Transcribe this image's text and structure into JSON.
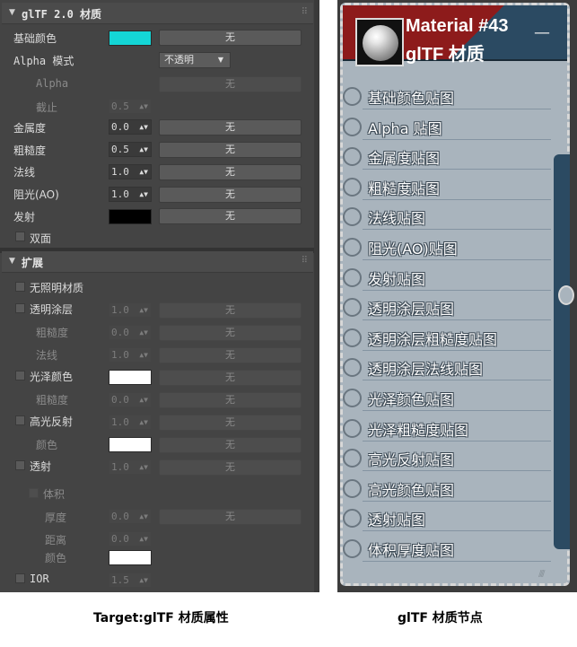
{
  "left_panel": {
    "gltf_rollout": {
      "title": "glTF 2.0 材质",
      "arrow": "▼",
      "grip": "⠿",
      "base_color": {
        "label": "基础颜色",
        "color": "#14d6d6",
        "map": "无"
      },
      "alpha_mode": {
        "label": "Alpha 模式",
        "value": "不透明",
        "arrow": "▼"
      },
      "alpha": {
        "label": "Alpha",
        "map": "无"
      },
      "cutoff": {
        "label": "截止",
        "value": "0.5"
      },
      "metallic": {
        "label": "金属度",
        "value": "0.0",
        "map": "无"
      },
      "roughness": {
        "label": "粗糙度",
        "value": "0.5",
        "map": "无"
      },
      "normal": {
        "label": "法线",
        "value": "1.0",
        "map": "无"
      },
      "occlusion": {
        "label": "阻光(AO)",
        "value": "1.0",
        "map": "无"
      },
      "emissive": {
        "label": "发射",
        "color": "#000000",
        "map": "无"
      },
      "double_sided": {
        "label": "双面"
      }
    },
    "extension_rollout": {
      "title": "扩展",
      "arrow": "▼",
      "grip": "⠿",
      "unlit": {
        "label": "无照明材质"
      },
      "clearcoat": {
        "label": "透明涂层",
        "value": "1.0",
        "map": "无"
      },
      "clearcoat_roughness": {
        "label": "粗糙度",
        "value": "0.0",
        "map": "无"
      },
      "clearcoat_normal": {
        "label": "法线",
        "value": "1.0",
        "map": "无"
      },
      "sheen_color": {
        "label": "光泽颜色",
        "color": "#ffffff",
        "map": "无"
      },
      "sheen_roughness": {
        "label": "粗糙度",
        "value": "0.0",
        "map": "无"
      },
      "specular": {
        "label": "高光反射",
        "value": "1.0",
        "map": "无"
      },
      "specular_color": {
        "label": "颜色",
        "color": "#ffffff",
        "map": "无"
      },
      "transmission": {
        "label": "透射",
        "value": "1.0",
        "map": "无"
      },
      "volume": {
        "label": "体积"
      },
      "thickness": {
        "label": "厚度",
        "value": "0.0",
        "map": "无"
      },
      "distance": {
        "label": "距离",
        "value": "0.0"
      },
      "volume_color": {
        "label": "颜色",
        "color": "#ffffff"
      },
      "ior": {
        "label": "IOR",
        "value": "1.5"
      }
    },
    "spin_arrows": "▲▼"
  },
  "node": {
    "title_line1": "Material #43",
    "title_line2": "glTF 材质",
    "minimize": "—",
    "resize": "////",
    "slots": [
      "基础颜色贴图",
      "Alpha 贴图",
      "金属度贴图",
      "粗糙度贴图",
      "法线贴图",
      "阻光(AO)贴图",
      "发射贴图",
      "透明涂层贴图",
      "透明涂层粗糙度贴图",
      "透明涂层法线贴图",
      "光泽颜色贴图",
      "光泽粗糙度贴图",
      "高光反射贴图",
      "高光颜色贴图",
      "透射贴图",
      "体积厚度贴图"
    ]
  },
  "captions": {
    "left": "Target:glTF 材质属性",
    "right": "glTF 材质节点"
  }
}
